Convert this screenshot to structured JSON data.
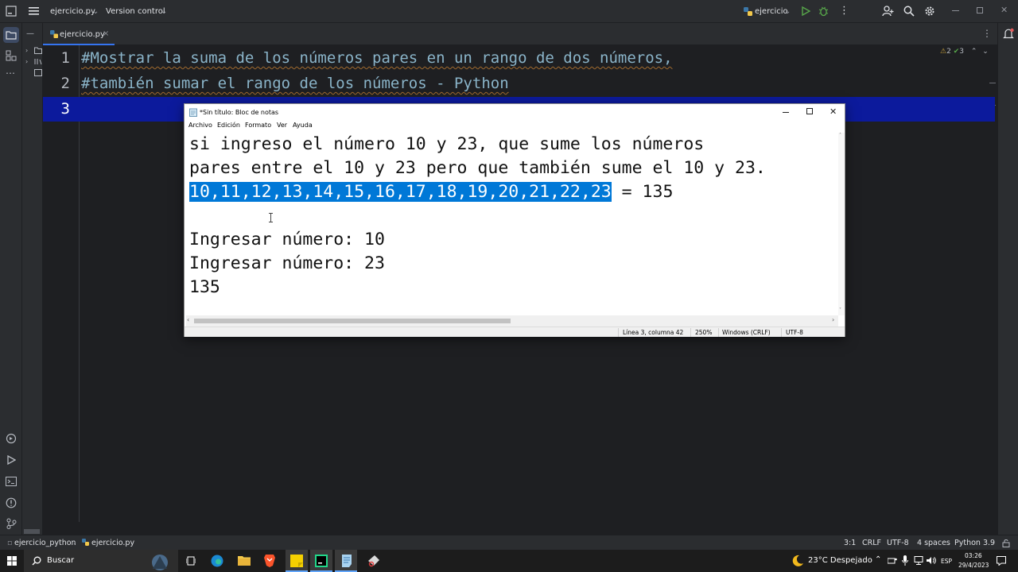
{
  "ide": {
    "project_name": "ejercicio.py",
    "version_control": "Version control",
    "run_config": "ejercicio",
    "tab_label": "ejercicio.py",
    "inspection": {
      "warnings": "2",
      "ok": "3"
    },
    "lines": [
      {
        "number": "1",
        "text": "#Mostrar la suma de los números pares en un rango de dos números,"
      },
      {
        "number": "2",
        "text": "#también sumar el rango de los números - Python"
      },
      {
        "number": "3",
        "text": ""
      }
    ],
    "breadcrumb": {
      "project": "ejercicio_python",
      "file": "ejercicio.py"
    },
    "status": {
      "position": "3:1",
      "line_sep": "CRLF",
      "encoding": "UTF-8",
      "indent": "4 spaces",
      "interpreter": "Python 3.9"
    }
  },
  "notepad": {
    "title": "*Sin título: Bloc de notas",
    "menu": [
      "Archivo",
      "Edición",
      "Formato",
      "Ver",
      "Ayuda"
    ],
    "text_lines": {
      "l1": "si ingreso el número 10 y 23, que sume los números",
      "l2": "pares entre el 10 y 23 pero que también sume el 10 y 23.",
      "l3_selected": "10,11,12,13,14,15,16,17,18,19,20,21,22,23",
      "l3_rest": " = 135",
      "l4": "",
      "l5": "Ingresar número: 10",
      "l6": "Ingresar número: 23",
      "l7": "135"
    },
    "status": {
      "position": "Línea 3, columna 42",
      "zoom": "250%",
      "line_endings": "Windows (CRLF)",
      "encoding": "UTF-8"
    }
  },
  "taskbar": {
    "search_placeholder": "Buscar",
    "weather": "23°C  Despejado",
    "language": "ESP",
    "time": "03:26",
    "date": "29/4/2023"
  },
  "colors": {
    "ide_bg": "#1e1f22",
    "ide_panel": "#2b2d30",
    "comment": "#8ab4c9",
    "current_line": "#0c1a9c",
    "selection": "#0078d7",
    "accent": "#3574f0"
  }
}
